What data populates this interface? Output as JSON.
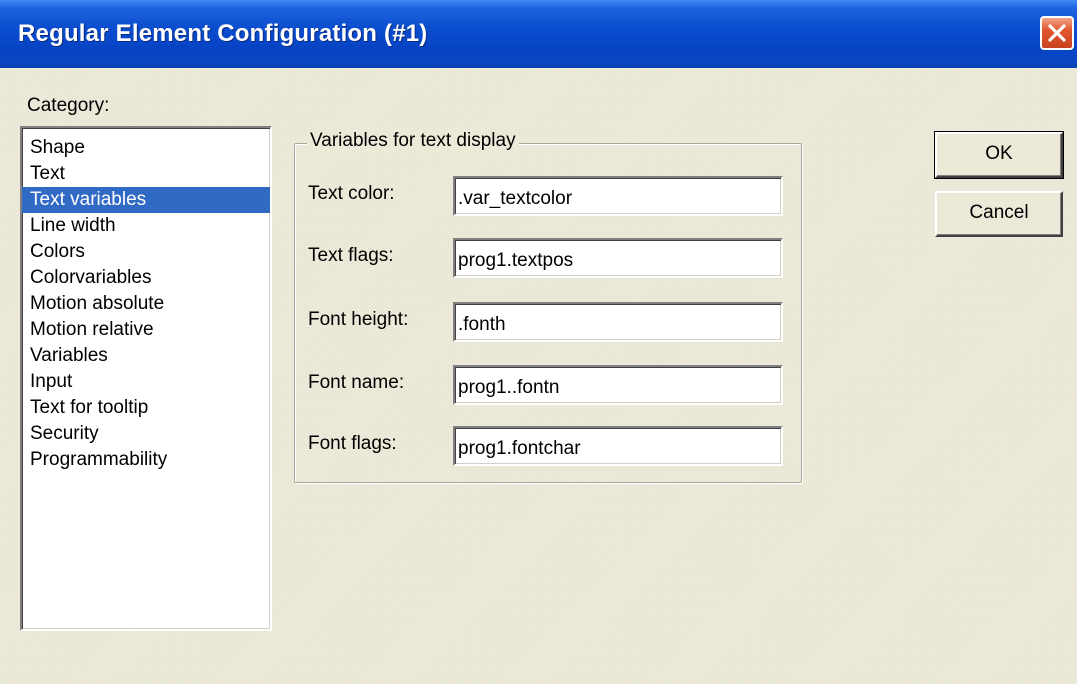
{
  "window": {
    "title": "Regular Element Configuration (#1)"
  },
  "category": {
    "label": "Category:",
    "selected": "Text variables",
    "items": [
      "Shape",
      "Text",
      "Text variables",
      "Line width",
      "Colors",
      "Colorvariables",
      "Motion absolute",
      "Motion relative",
      "Variables",
      "Input",
      "Text for tooltip",
      "Security",
      "Programmability"
    ]
  },
  "group": {
    "title": "Variables for text display",
    "fields": [
      {
        "label": "Text color:",
        "value": ".var_textcolor"
      },
      {
        "label": "Text flags:",
        "value": "prog1.textpos"
      },
      {
        "label": "Font height:",
        "value": ".fonth"
      },
      {
        "label": "Font name:",
        "value": "prog1..fontn"
      },
      {
        "label": "Font flags:",
        "value": "prog1.fontchar"
      }
    ]
  },
  "buttons": {
    "ok": "OK",
    "cancel": "Cancel"
  },
  "colors": {
    "titlebar": "#0a4ecf",
    "selection": "#316ac5",
    "dialog_bg": "#ece9d8",
    "close_button": "#e2572f"
  },
  "icons": {
    "close": "close-icon"
  }
}
